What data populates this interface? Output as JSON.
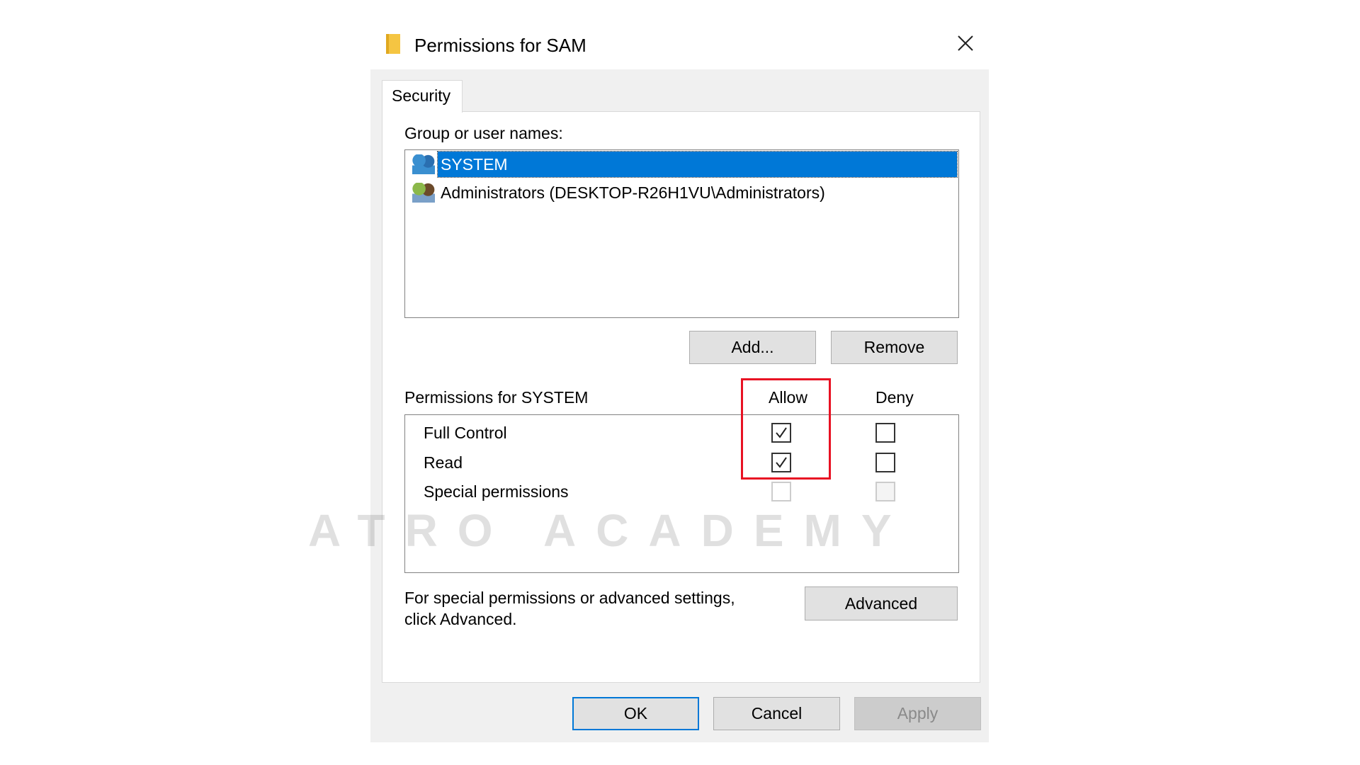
{
  "window": {
    "title": "Permissions for SAM",
    "icon": "folder-icon",
    "close": "close-icon"
  },
  "tabs": [
    {
      "label": "Security",
      "active": true
    }
  ],
  "group_label": "Group or user names:",
  "users": [
    {
      "name": "SYSTEM",
      "selected": true,
      "icon": "users-group-icon"
    },
    {
      "name": "Administrators (DESKTOP-R26H1VU\\Administrators)",
      "selected": false,
      "icon": "admins-group-icon"
    }
  ],
  "buttons": {
    "add": "Add...",
    "remove": "Remove",
    "advanced": "Advanced",
    "ok": "OK",
    "cancel": "Cancel",
    "apply": "Apply"
  },
  "permissions": {
    "label": "Permissions for SYSTEM",
    "allow_header": "Allow",
    "deny_header": "Deny",
    "rows": [
      {
        "name": "Full Control",
        "allow": true,
        "deny": false,
        "enabled": true
      },
      {
        "name": "Read",
        "allow": true,
        "deny": false,
        "enabled": true
      },
      {
        "name": "Special permissions",
        "allow": false,
        "deny": false,
        "enabled": false
      }
    ]
  },
  "advanced_hint_line1": "For special permissions or advanced settings,",
  "advanced_hint_line2": "click Advanced.",
  "highlight_color": "#e81123",
  "selection_color": "#0078d7",
  "watermark": "ATRO ACADEMY"
}
